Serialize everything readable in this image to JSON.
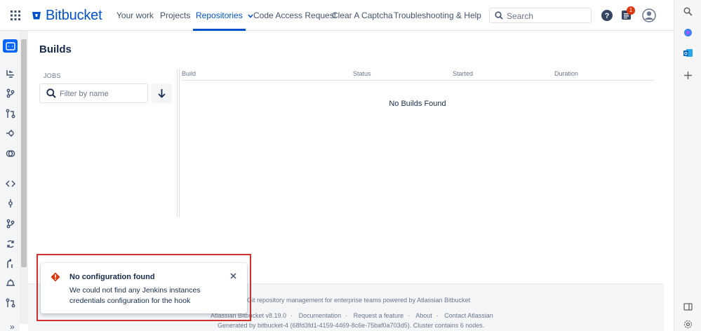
{
  "nav": {
    "brand": "Bitbucket",
    "items": [
      "Your work",
      "Projects",
      "Repositories",
      "Code Access Request",
      "Clear A Captcha",
      "Troubleshooting & Help"
    ],
    "active": "Repositories",
    "search_placeholder": "Search",
    "notification_count": "1"
  },
  "page": {
    "title": "Builds",
    "jobs_label": "JOBS",
    "filter_placeholder": "Filter by name",
    "columns": [
      "Build",
      "Status",
      "Started",
      "Duration"
    ],
    "empty_message": "No Builds Found"
  },
  "footer": {
    "line1": "Git repository management for enterprise teams powered by Atlassian Bitbucket",
    "links": [
      "Atlassian Bitbucket v8.19.0",
      "Documentation",
      "Request a feature",
      "About",
      "Contact Atlassian"
    ],
    "generated": "Generated by bitbucket-4 (68fd3fd1-4159-4469-8c6e-75baf0a703d5). Cluster contains 6 nodes."
  },
  "flag": {
    "title": "No configuration found",
    "body": "We could not find any Jenkins instances credentials configuration for the hook"
  },
  "colors": {
    "brand": "#0052cc",
    "error": "#de350b",
    "highlight": "#d32f2f"
  },
  "icons": {
    "left_sidebar": [
      "repo-icon",
      "source-icon",
      "branches-icon",
      "pull-requests-icon",
      "builds-icon",
      "jira-icon",
      "code-icon",
      "commits-icon",
      "branches-icon",
      "sync-icon",
      "deploy-icon",
      "webhooks-icon",
      "pull-requests-icon"
    ],
    "right_sidebar": [
      "search-icon",
      "copilot-icon",
      "outlook-icon",
      "add-icon",
      "sidebar-icon",
      "settings-icon"
    ]
  }
}
